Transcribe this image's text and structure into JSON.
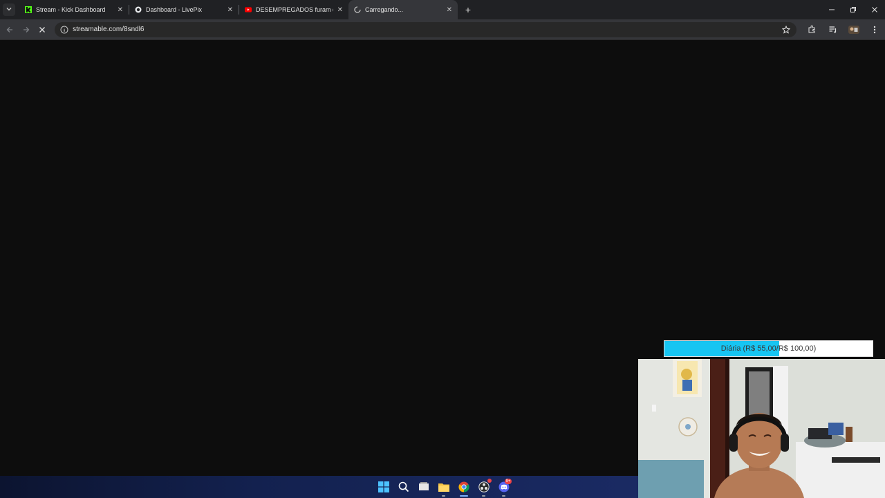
{
  "browser": {
    "tabs": [
      {
        "title": "Stream - Kick Dashboard",
        "favicon": "kick-icon",
        "active": false
      },
      {
        "title": "Dashboard - LivePix",
        "favicon": "livepix-icon",
        "active": false
      },
      {
        "title": "DESEMPREGADOS furam o BAI",
        "favicon": "youtube-icon",
        "active": false
      },
      {
        "title": "Carregando...",
        "favicon": "loading-spinner-icon",
        "active": true
      }
    ],
    "close_glyph": "✕",
    "new_tab_glyph": "+",
    "address": "streamable.com/8sndl6"
  },
  "overlay": {
    "goal_label": "Diária (R$ 55,00/R$ 100,00)",
    "goal_progress": 0.55,
    "goal_color": "#17c5f2"
  },
  "colors": {
    "tabstrip": "#202124",
    "toolbar": "#35363a",
    "page_bg": "#0d0d0d"
  },
  "taskbar": {
    "icons": [
      "windows-start-icon",
      "search-icon",
      "task-view-icon",
      "file-explorer-icon",
      "chrome-icon",
      "obs-icon",
      "discord-icon"
    ],
    "discord_badge": "9+"
  }
}
